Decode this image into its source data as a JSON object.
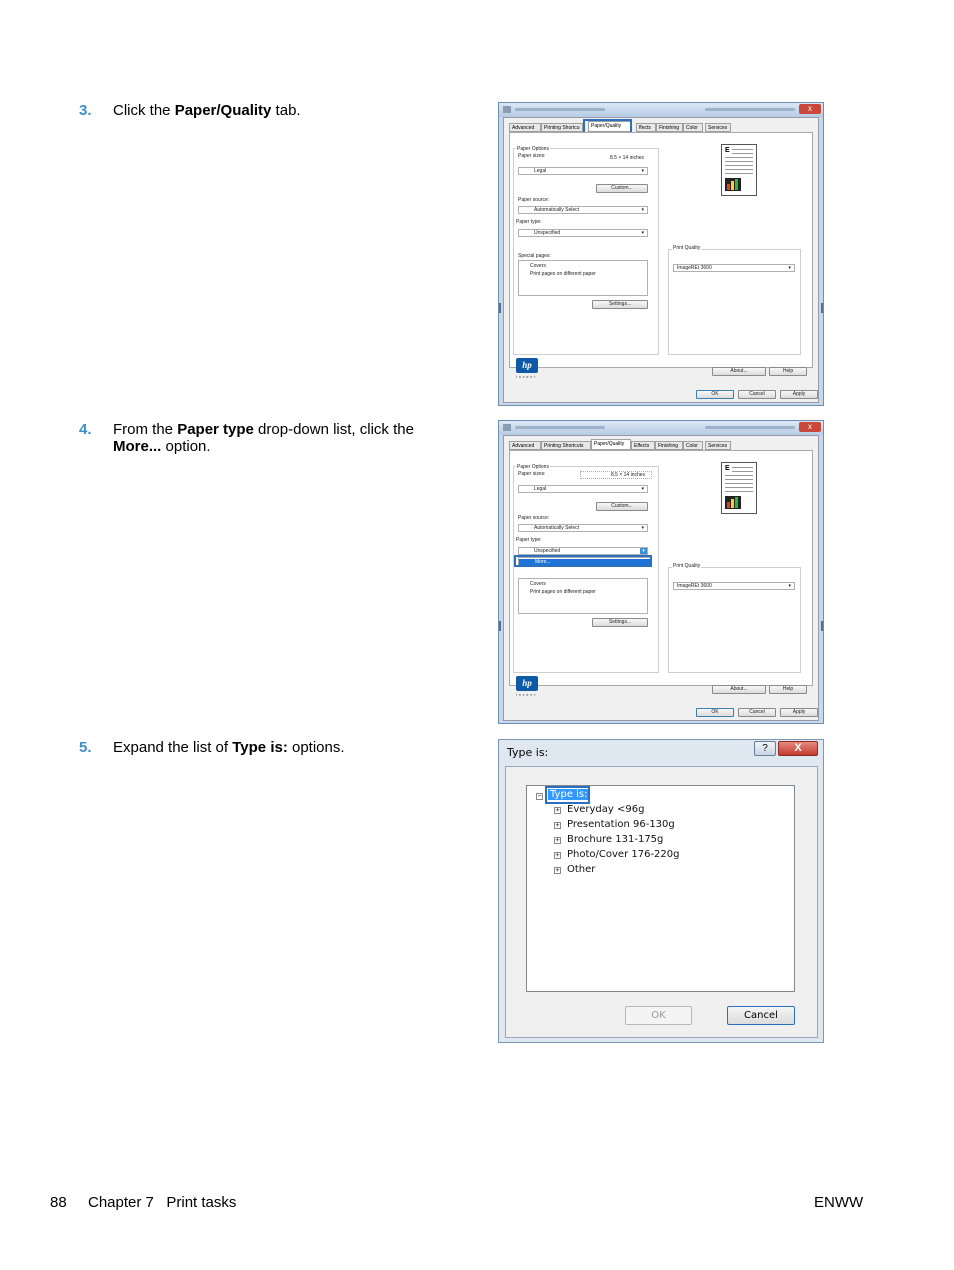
{
  "steps": [
    {
      "num": "3.",
      "pre": "Click the ",
      "bold1": "Paper/Quality",
      "post": " tab."
    },
    {
      "num": "4.",
      "pre": "From the ",
      "bold1": "Paper type",
      "mid": " drop-down list, click the ",
      "bold2": "More...",
      "post": " option."
    },
    {
      "num": "5.",
      "pre": "Expand the list of ",
      "bold1": "Type is:",
      "post": " options."
    }
  ],
  "printer_dialog": {
    "tabs": [
      "Advanced",
      "Printing Shortcuts",
      "Paper/Quality",
      "Effects",
      "Finishing",
      "Color",
      "Services"
    ],
    "tabs_trunc1": "Printing Shortcu",
    "tabs_trunc2": "ffects",
    "paper_options_label": "Paper Options",
    "paper_sizes_label": "Paper sizes:",
    "paper_sizes_value": "8.5 × 14 inches",
    "paper_size_select": "Legal",
    "custom_button": "Custom...",
    "paper_source_label": "Paper source:",
    "paper_source_value": "Automatically Select",
    "paper_type_label": "Paper type:",
    "paper_type_value": "Unspecified",
    "paper_type_more": "More...",
    "special_pages_label": "Special pages:",
    "special_pages_items": [
      "Covers",
      "Print pages on different paper"
    ],
    "settings_button": "Settings...",
    "print_quality_label": "Print Quality",
    "print_quality_value": "ImageREt 3600",
    "about_button": "About...",
    "help_button": "Help",
    "ok_button": "OK",
    "cancel_button": "Cancel",
    "apply_button": "Apply",
    "logo_text": "hp",
    "logo_sub": "invent",
    "close_glyph": "x"
  },
  "type_dialog": {
    "title": "Type is:",
    "help_glyph": "?",
    "close_glyph": "X",
    "root": "Type is:",
    "root_toggle": "−",
    "child_toggle": "+",
    "children": [
      "Everyday <96g",
      "Presentation 96-130g",
      "Brochure 131-175g",
      "Photo/Cover 176-220g",
      "Other"
    ],
    "ok_button": "OK",
    "cancel_button": "Cancel"
  },
  "footer": {
    "page_number": "88",
    "chapter": "Chapter 7   Print tasks",
    "right": "ENWW"
  },
  "colors": {
    "step_number": "#3d8fc9",
    "highlight": "#2b6fbf",
    "selection": "#3399ff"
  }
}
